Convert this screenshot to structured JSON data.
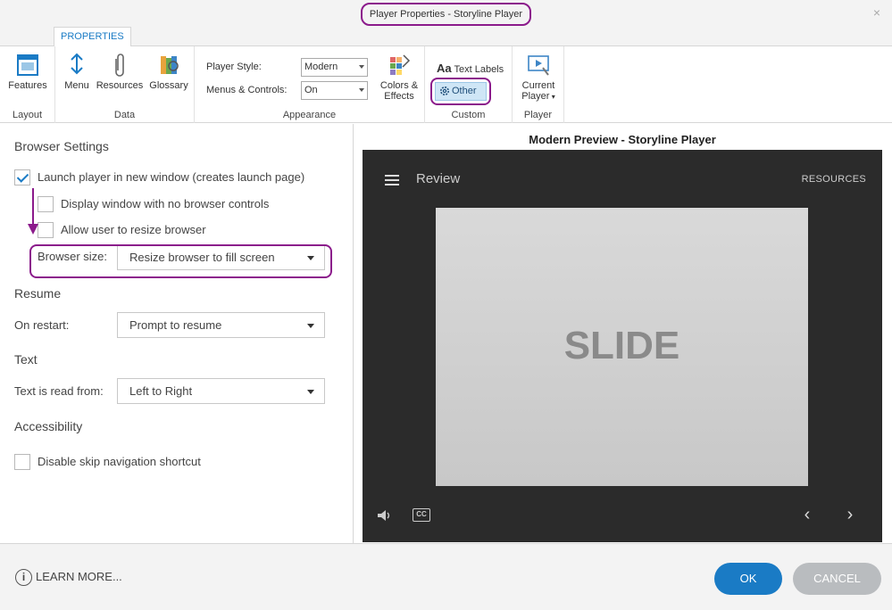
{
  "window": {
    "title": "Player Properties - Storyline Player",
    "close_glyph": "×"
  },
  "ribbon": {
    "tab": "PROPERTIES",
    "groups": {
      "layout": {
        "label": "Layout",
        "features": "Features"
      },
      "data": {
        "label": "Data",
        "menu": "Menu",
        "resources": "Resources",
        "glossary": "Glossary"
      },
      "appearance": {
        "label": "Appearance",
        "player_style_label": "Player Style:",
        "player_style_value": "Modern",
        "menus_controls_label": "Menus & Controls:",
        "menus_controls_value": "On",
        "colors_effects_line1": "Colors &",
        "colors_effects_line2": "Effects"
      },
      "custom": {
        "label": "Custom",
        "text_labels_prefix": "Aa",
        "text_labels": "Text Labels",
        "other": "Other"
      },
      "player": {
        "label": "Player",
        "current_line1": "Current",
        "current_line2": "Player"
      }
    }
  },
  "settings": {
    "browser_heading": "Browser Settings",
    "launch_new_window": {
      "label": "Launch player in new window (creates launch page)",
      "checked": true
    },
    "no_browser_controls": {
      "label": "Display window with no browser controls",
      "checked": false
    },
    "allow_resize": {
      "label": "Allow user to resize browser",
      "checked": false
    },
    "browser_size_label": "Browser size:",
    "browser_size_value": "Resize browser to fill screen",
    "resume_heading": "Resume",
    "on_restart_label": "On restart:",
    "on_restart_value": "Prompt to resume",
    "text_heading": "Text",
    "text_read_label": "Text is read from:",
    "text_read_value": "Left to Right",
    "accessibility_heading": "Accessibility",
    "skip_nav": {
      "label": "Disable skip navigation shortcut",
      "checked": false
    }
  },
  "preview": {
    "title": "Modern Preview - Storyline Player",
    "review_title": "Review",
    "resources_link": "RESOURCES",
    "slide_text": "SLIDE",
    "cc_label": "CC",
    "prev_glyph": "‹",
    "next_glyph": "›"
  },
  "footer": {
    "info_glyph": "i",
    "learn_more": "LEARN MORE...",
    "ok": "OK",
    "cancel": "CANCEL"
  },
  "colors": {
    "accent": "#1a7bc5",
    "highlight": "#8b1a8b",
    "player_bg": "#2b2b2b"
  }
}
